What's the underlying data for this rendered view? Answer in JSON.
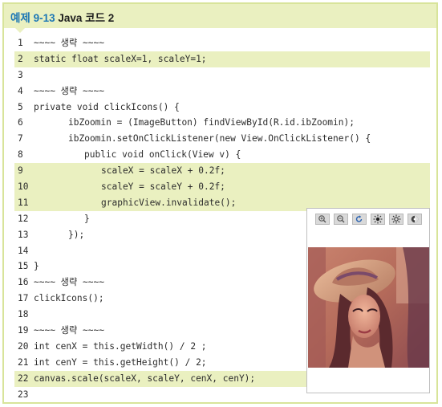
{
  "header": {
    "label": "예제 9-13",
    "title": "Java 코드 2"
  },
  "code_lines": [
    {
      "num": "1",
      "text": "~~~~ 생략 ~~~~",
      "indent": 0,
      "hl": false
    },
    {
      "num": "2",
      "text": "static float scaleX=1, scaleY=1;",
      "indent": 0,
      "hl": true
    },
    {
      "num": "3",
      "text": "",
      "indent": 0,
      "hl": false
    },
    {
      "num": "4",
      "text": "~~~~ 생략 ~~~~",
      "indent": 0,
      "hl": false
    },
    {
      "num": "5",
      "text": "private void clickIcons() {",
      "indent": 0,
      "hl": false
    },
    {
      "num": "6",
      "text": "ibZoomin = (ImageButton) findViewById(R.id.ibZoomin);",
      "indent": 1,
      "hl": false
    },
    {
      "num": "7",
      "text": "ibZoomin.setOnClickListener(new View.OnClickListener() {",
      "indent": 1,
      "hl": false
    },
    {
      "num": "8",
      "text": "public void onClick(View v) {",
      "indent": 2,
      "hl": false
    },
    {
      "num": "9",
      "text": "scaleX = scaleX + 0.2f;",
      "indent": 3,
      "hl": true
    },
    {
      "num": "10",
      "text": "scaleY = scaleY + 0.2f;",
      "indent": 3,
      "hl": true
    },
    {
      "num": "11",
      "text": "graphicView.invalidate();",
      "indent": 3,
      "hl": true
    },
    {
      "num": "12",
      "text": "}",
      "indent": 2,
      "hl": false
    },
    {
      "num": "13",
      "text": "});",
      "indent": 1,
      "hl": false
    },
    {
      "num": "14",
      "text": "",
      "indent": 0,
      "hl": false
    },
    {
      "num": "15",
      "text": "}",
      "indent": 0,
      "hl": false
    },
    {
      "num": "16",
      "text": "~~~~ 생략 ~~~~",
      "indent": 0,
      "hl": false
    },
    {
      "num": "17",
      "text": "clickIcons();",
      "indent": 0,
      "hl": false
    },
    {
      "num": "18",
      "text": "",
      "indent": 0,
      "hl": false
    },
    {
      "num": "19",
      "text": "~~~~ 생략 ~~~~",
      "indent": 0,
      "hl": false
    },
    {
      "num": "20",
      "text": "int cenX = this.getWidth() / 2 ;",
      "indent": 0,
      "hl": false
    },
    {
      "num": "21",
      "text": "int cenY = this.getHeight() / 2;",
      "indent": 0,
      "hl": false
    },
    {
      "num": "22",
      "text": "canvas.scale(scaleX, scaleY, cenX, cenY);",
      "indent": 0,
      "hl": true
    },
    {
      "num": "23",
      "text": "",
      "indent": 0,
      "hl": false
    }
  ],
  "preview": {
    "toolbar_icons": [
      "zoom-in-icon",
      "zoom-out-icon",
      "rotate-icon",
      "brightness-up-icon",
      "brightness-down-icon",
      "grayscale-icon"
    ],
    "photo_description_icon": "portrait-photo"
  },
  "colors": {
    "highlight": "#eaf0c0",
    "accent": "#1c77b5",
    "border": "#d8e49a"
  }
}
